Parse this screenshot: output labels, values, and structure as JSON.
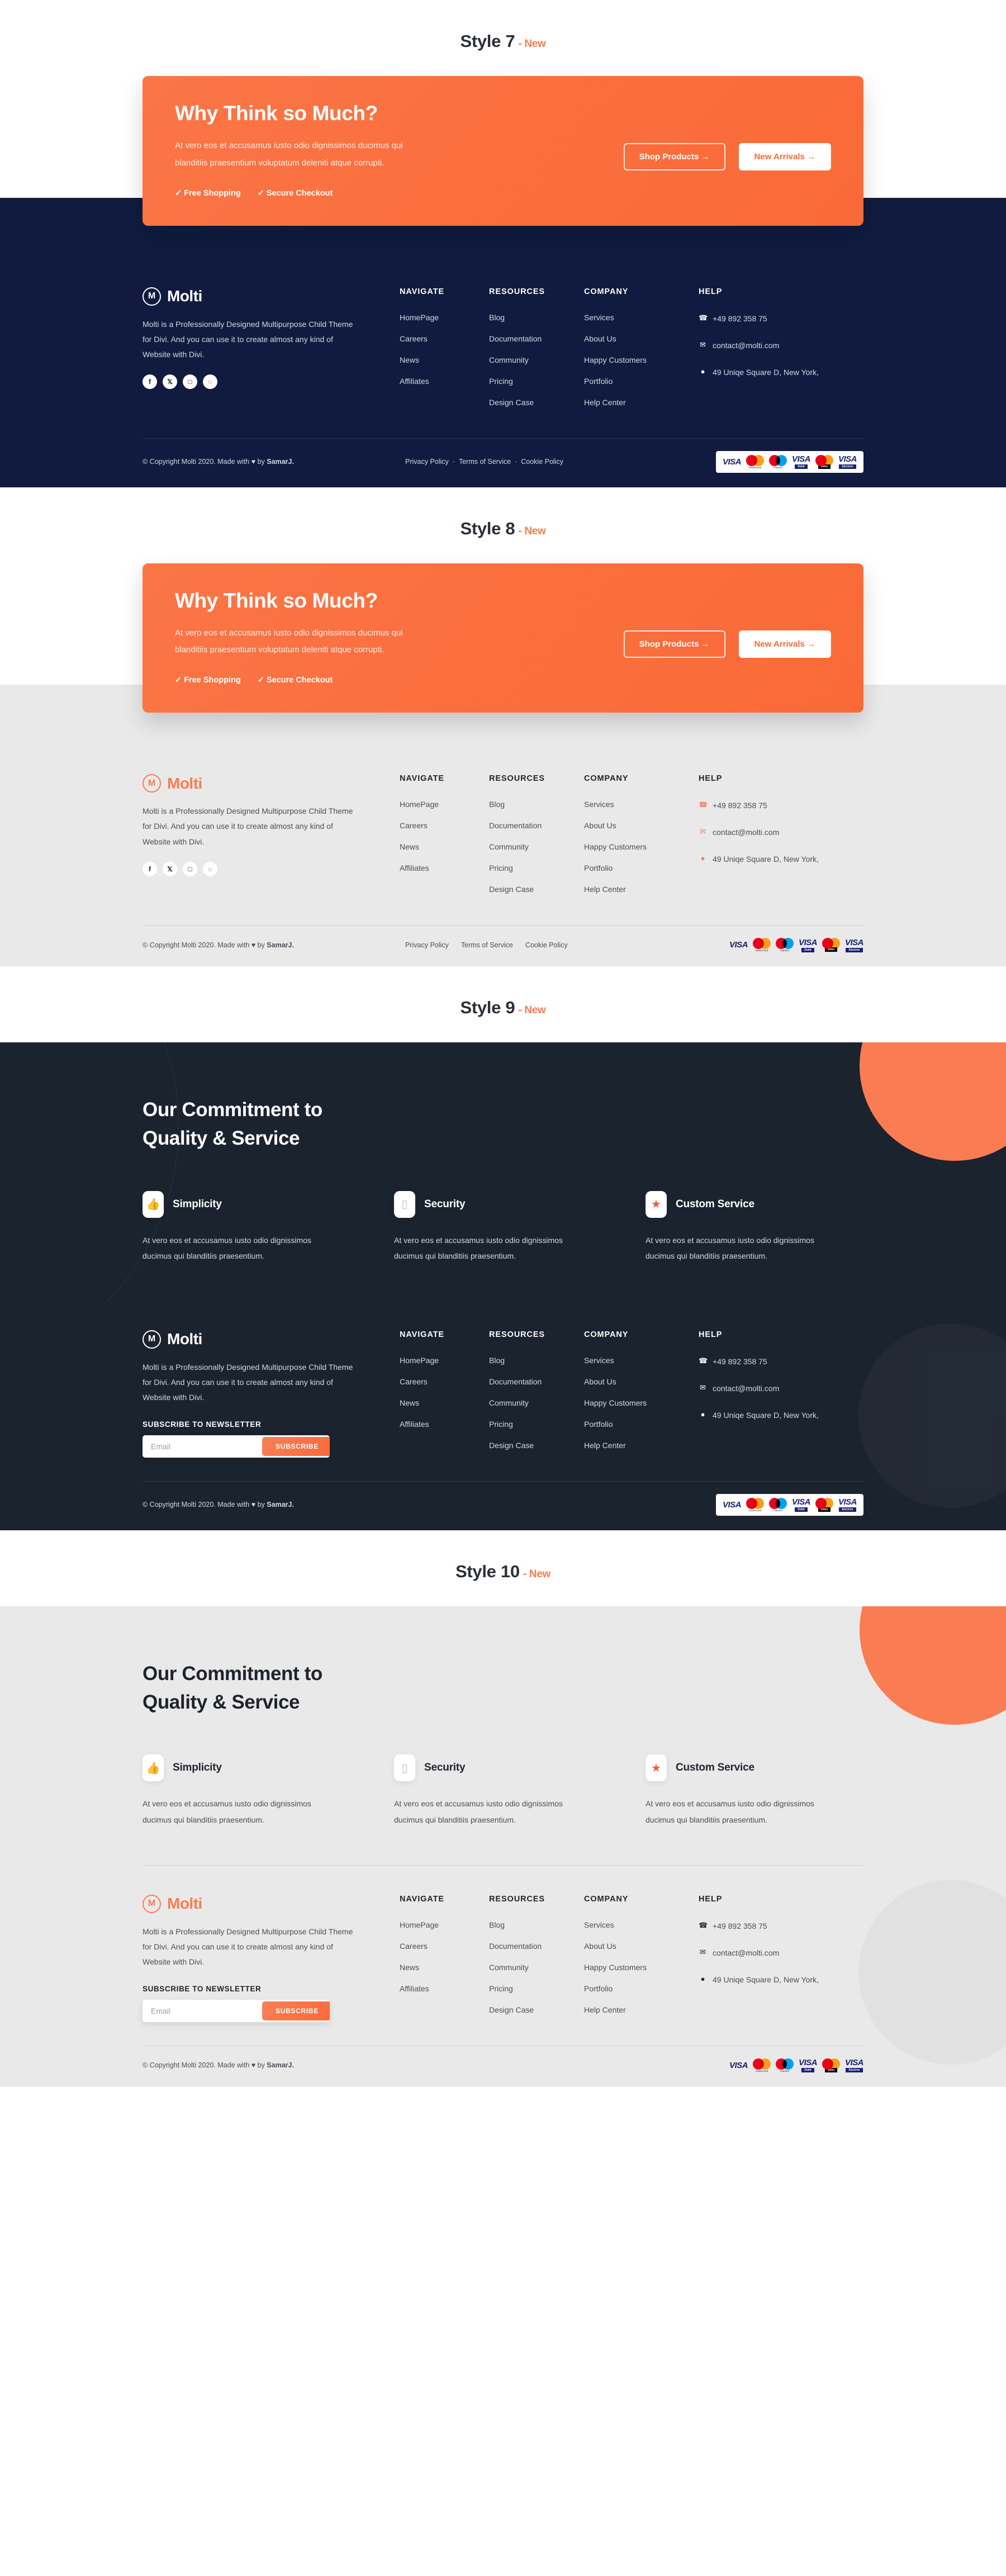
{
  "brand": {
    "name": "Molti",
    "mark": "M",
    "about": "Molti is a Professionally Designed Multipurpose Child Theme for Divi. And you can use it to create almost any kind of Website with Divi.",
    "accent": "#fa7c52",
    "navy": "#101b3f",
    "dark": "#1b232f",
    "light": "#e9e9e9"
  },
  "styles": [
    {
      "label": "Style 7",
      "tag": "- New"
    },
    {
      "label": "Style 8",
      "tag": "- New"
    },
    {
      "label": "Style 9",
      "tag": "- New"
    },
    {
      "label": "Style 10",
      "tag": "- New"
    }
  ],
  "cta": {
    "title": "Why Think so Much?",
    "desc": "At vero eos et accusamus iusto odio dignissimos ducimus qui blanditiis praesentium voluptatum deleniti atque corrupti.",
    "badge1": "✓ Free Shopping",
    "badge2": "✓ Secure Checkout",
    "btn_primary": "Shop Products  →",
    "btn_secondary": "New Arrivals  →"
  },
  "commitment": {
    "title_line1": "Our Commitment to",
    "title_line2": "Quality & Service",
    "features": [
      {
        "icon": "thumbs-up",
        "glyph": "👍",
        "name": "Simplicity",
        "desc": "At vero eos et accusamus iusto odio dignissimos ducimus qui blanditiis praesentium."
      },
      {
        "icon": "shield",
        "glyph": "▯",
        "name": "Security",
        "desc": "At vero eos et accusamus iusto odio dignissimos ducimus qui blanditiis praesentium."
      },
      {
        "icon": "star",
        "glyph": "★",
        "name": "Custom Service",
        "desc": "At vero eos et accusamus iusto odio dignissimos ducimus qui blanditiis praesentium."
      }
    ]
  },
  "footer": {
    "socials": [
      "f",
      "𝕏",
      "□",
      "◌"
    ],
    "columns": [
      {
        "head": "NAVIGATE",
        "links": [
          "HomePage",
          "Careers",
          "News",
          "Affiliates"
        ]
      },
      {
        "head": "RESOURCES",
        "links": [
          "Blog",
          "Documentation",
          "Community",
          "Pricing",
          "Design Case"
        ]
      },
      {
        "head": "COMPANY",
        "links": [
          "Services",
          "About Us",
          "Happy Customers",
          "Portfolio",
          "Help Center"
        ]
      }
    ],
    "help": {
      "head": "HELP",
      "phone": "+49 892 358 75",
      "email": "contact@molti.com",
      "address": "49 Uniqe Square D, New York,"
    },
    "newsletter": {
      "head": "SUBSCRIBE TO NEWSLETTER",
      "placeholder": "Email",
      "button": "SUBSCRIBE"
    },
    "copyright": "© Copyright Molti 2020. Made with ♥ by ",
    "copyright_author": "SamarJ.",
    "legal": [
      "Privacy Policy",
      "·",
      "Terms of Service",
      "·",
      "Cookie Policy"
    ],
    "legal_plain": [
      "Privacy Policy",
      "Terms of Service",
      "Cookie Policy"
    ],
    "payments": [
      "VISA",
      "mastercard",
      "maestro",
      "VISA Debit",
      "mastercard Debit",
      "VISA Electron"
    ]
  }
}
